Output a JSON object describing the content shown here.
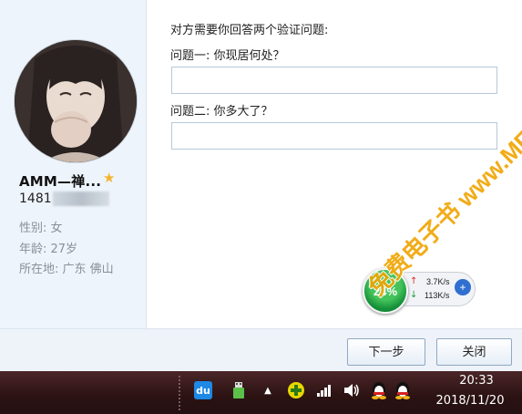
{
  "dialog": {
    "heading": "对方需要你回答两个验证问题:",
    "question1_label": "问题一: 你现居何处？",
    "question1_value": "",
    "question2_label": "问题二: 你多大了？",
    "question2_value": "",
    "next_button": "下一步",
    "close_button": "关闭"
  },
  "profile": {
    "nickname": "AMM—禅...",
    "qq_prefix": "1481",
    "gender": "性别: 女",
    "age": "年龄: 27岁",
    "location": "所在地: 广东  佛山",
    "star_color": "#f3b42c"
  },
  "net_monitor": {
    "percent": "24%",
    "upload": "3.7K/s",
    "download": "113K/s"
  },
  "taskbar": {
    "time": "20:33",
    "date": "2018/11/20",
    "icons": [
      "baidu-du-icon",
      "usb-icon",
      "tray-up-arrow-icon",
      "add-plus-icon",
      "network-signal-icon",
      "volume-icon",
      "qq-penguin-icon"
    ]
  },
  "watermark": "免费电子书 www.MFsese.com"
}
